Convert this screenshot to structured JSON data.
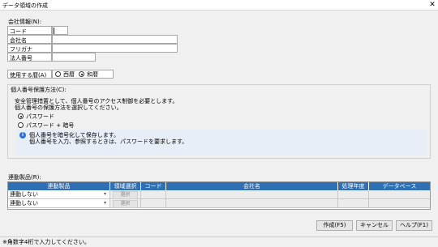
{
  "window": {
    "title": "データ領域の作成",
    "close": "✕"
  },
  "company": {
    "section_label": "会社情報(N):",
    "fields": [
      {
        "label": "コード",
        "value": ""
      },
      {
        "label": "会社名",
        "value": ""
      },
      {
        "label": "フリガナ",
        "value": ""
      },
      {
        "label": "法人番号",
        "value": ""
      }
    ]
  },
  "calendar": {
    "label": "使用する暦(A)",
    "options": [
      "西暦",
      "和暦"
    ],
    "selected": "和暦"
  },
  "mynumber": {
    "group_label": "個人番号保護方法(C):",
    "desc_lines": [
      "安全管理措置として、個人番号のアクセス制御を必要とします。",
      "個人番号の保護方法を選択してください。"
    ],
    "options": [
      "パスワード",
      "パスワード + 暗号"
    ],
    "selected": "パスワード",
    "info_lines": [
      "個人番号を暗号化して保存します。",
      "個人番号を入力、参照するときは、パスワードを要求します。"
    ]
  },
  "linked": {
    "label": "連動製品(R):",
    "columns": [
      "連動製品",
      "領域選択",
      "コード",
      "会社名",
      "処理年度",
      "データベース"
    ],
    "rows": [
      {
        "product": "連動しない",
        "select": "選択",
        "code": "",
        "company": "",
        "year": "",
        "db": ""
      },
      {
        "product": "連動しない",
        "select": "選択",
        "code": "",
        "company": "",
        "year": "",
        "db": ""
      }
    ]
  },
  "buttons": {
    "create": "作成(F5)",
    "cancel": "キャンセル",
    "help": "ヘルプ(F1)"
  },
  "status": "※角数字4桁で入力してください。"
}
